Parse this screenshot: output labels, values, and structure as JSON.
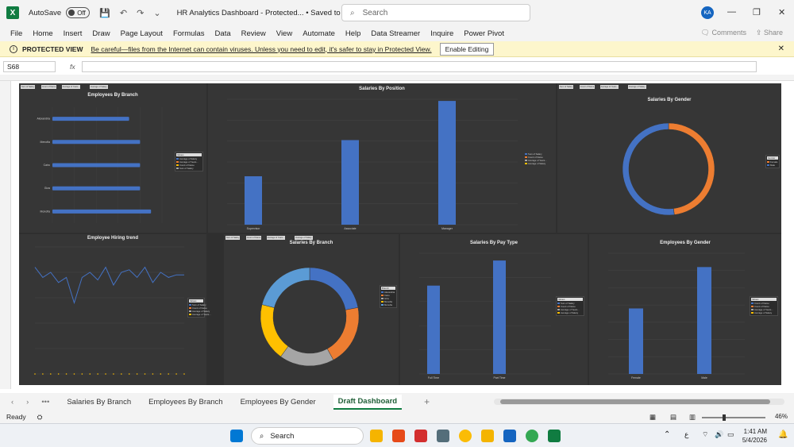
{
  "app": {
    "autosave_label": "AutoSave",
    "autosave_state": "Off",
    "doc_title": "HR Analytics Dashboard  -  Protected...  •  Saved to this PC ⌄",
    "search_placeholder": "Search",
    "user_initials": "KA"
  },
  "menu": [
    "File",
    "Home",
    "Insert",
    "Draw",
    "Page Layout",
    "Formulas",
    "Data",
    "Review",
    "View",
    "Automate",
    "Help",
    "Data Streamer",
    "Inquire",
    "Power Pivot"
  ],
  "menu_right": {
    "comments": "Comments",
    "share": "Share"
  },
  "protected": {
    "label": "PROTECTED VIEW",
    "message": "Be careful—files from the Internet can contain viruses. Unless you need to edit, it's safer to stay in Protected View.",
    "button": "Enable Editing"
  },
  "formula": {
    "namebox": "S68",
    "fx": "fx",
    "value": ""
  },
  "panels": {
    "emp_branch": {
      "title": "Employees By Branch",
      "filter_tags": [
        "Sum of Salary",
        "Count of Name",
        "Average of Years...",
        "Average of Salary"
      ],
      "legend_title": "Values",
      "legend": [
        "Average of Salary",
        "Average of Years...",
        "Count of Name",
        "Sum of Salary"
      ]
    },
    "sal_position": {
      "title": "Salaries By Position",
      "legend": [
        "Sum of Salary",
        "Count of Name",
        "Average of Years...",
        "Average of Salary"
      ]
    },
    "sal_gender": {
      "title": "Salaries By Gender",
      "filter_tags": [
        "Sum of Salary",
        "Count of Name",
        "Average of Years...",
        "Average of Salary"
      ],
      "legend_title": "Gender",
      "legend": [
        "Female",
        "Male"
      ]
    },
    "hiring": {
      "title": "Employee Hiring trend",
      "legend_title": "Values",
      "legend": [
        "Sum of Salary",
        "Count of Name",
        "Average of Salary",
        "Average of Years..."
      ]
    },
    "sal_branch": {
      "title": "Salaries By Branch",
      "filter_tags": [
        "Sum of Salary",
        "Count of Name",
        "Average of Years...",
        "Average of Salary"
      ],
      "legend_title": "Branch",
      "legend": [
        "Alexandria",
        "Cairo",
        "Giza",
        "Menofia",
        "Monufia"
      ]
    },
    "pay_type": {
      "title": "Salaries By Pay Type",
      "legend_title": "Values",
      "legend": [
        "Sum of Salary",
        "Count of Name",
        "Average of Years...",
        "Average of Salary"
      ]
    },
    "emp_gender": {
      "title": "Employees By Gender",
      "legend_title": "Values",
      "legend": [
        "Count of Name",
        "Count of Name",
        "Average of Years...",
        "Average of Salary"
      ]
    }
  },
  "chart_data": [
    {
      "type": "bar",
      "title": "Employees By Branch",
      "categories": [
        "Monofia",
        "Giza",
        "Cairo",
        "Menofia",
        "Alexandria"
      ],
      "series": [
        {
          "values": [
            9,
            8,
            8,
            8,
            7
          ]
        }
      ],
      "bar_color": "#4472c4"
    },
    {
      "type": "bar",
      "title": "Salaries By Position",
      "categories": [
        "Supervisor",
        "Associate",
        "Manager"
      ],
      "series": [
        {
          "values": [
            2316000,
            4046000,
            5920000
          ]
        }
      ],
      "bar_color": "#4472c4"
    },
    {
      "type": "pie",
      "title": "Salaries By Gender",
      "categories": [
        "Female",
        "Male"
      ],
      "values": [
        48,
        52
      ],
      "colors": [
        "#ed7d31",
        "#4472c4"
      ]
    },
    {
      "type": "line",
      "title": "Employee Hiring trend",
      "series": [
        {
          "values": [
            420000,
            380000,
            400000,
            360000,
            380000,
            280000,
            380000,
            400000,
            370000,
            420000,
            350000,
            400000,
            410000,
            380000,
            420000,
            360000,
            400000,
            380000,
            390000,
            390000
          ]
        }
      ],
      "line_color": "#4472c4"
    },
    {
      "type": "pie",
      "title": "Salaries By Branch",
      "categories": [
        "Alexandria",
        "Cairo",
        "Giza",
        "Menofia",
        "Monufia"
      ],
      "values": [
        22,
        20,
        18,
        19,
        21
      ],
      "colors": [
        "#4472c4",
        "#ed7d31",
        "#a5a5a5",
        "#ffc000",
        "#5b9bd5"
      ]
    },
    {
      "type": "bar",
      "title": "Salaries By Pay Type",
      "categories": [
        "Full Time",
        "Part Time"
      ],
      "series": [
        {
          "values": [
            3660000,
            4700000
          ]
        }
      ],
      "bar_color": "#4472c4"
    },
    {
      "type": "bar",
      "title": "Employees By Gender",
      "categories": [
        "Female",
        "Male"
      ],
      "series": [
        {
          "values": [
            19,
            31
          ]
        }
      ],
      "bar_color": "#4472c4"
    }
  ],
  "tabs": {
    "items": [
      "Salaries By Branch",
      "Employees By Branch",
      "Employees By Gender",
      "Draft Dashboard"
    ],
    "active": "Draft Dashboard"
  },
  "status": {
    "ready": "Ready",
    "zoom": "46%"
  },
  "taskbar": {
    "search": "Search",
    "time": "1:41 AM",
    "date": "5/4/2026",
    "lang": "ع"
  }
}
